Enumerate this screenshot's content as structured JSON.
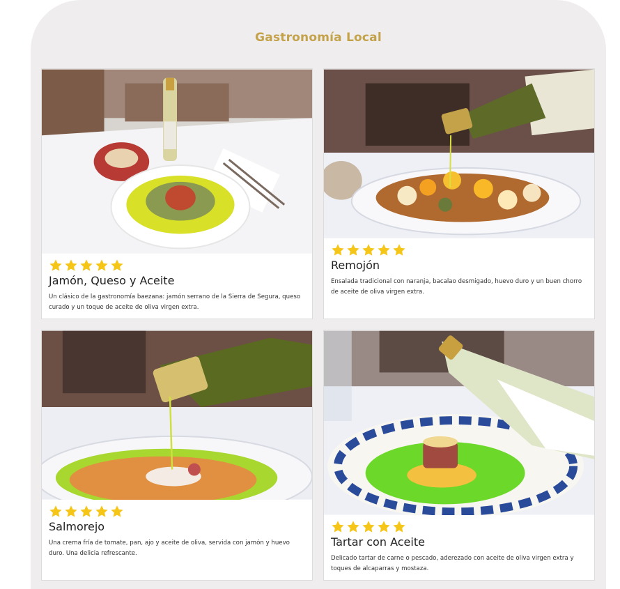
{
  "section": {
    "title": "Gastronomía Local"
  },
  "accent_color": "#c4a24a",
  "star_color": "#f5c518",
  "cards": [
    {
      "rating": 5,
      "image_icon": "dish-photo-icon",
      "title": "Jamón, Queso y Aceite",
      "description": "Un clásico de la gastronomía baezana: jamón serrano de la Sierra de Segura, queso curado y un toque de aceite de oliva virgen extra."
    },
    {
      "rating": 5,
      "image_icon": "dish-photo-icon",
      "title": "Remojón",
      "description": "Ensalada tradicional con naranja, bacalao desmigado, huevo duro y un buen chorro de aceite de oliva virgen extra."
    },
    {
      "rating": 5,
      "image_icon": "dish-photo-icon",
      "title": "Salmorejo",
      "description": "Una crema fría de tomate, pan, ajo y aceite de oliva, servida con jamón y huevo duro. Una delicia refrescante."
    },
    {
      "rating": 5,
      "image_icon": "dish-photo-icon",
      "title": "Tartar con Aceite",
      "description": "Delicado tartar de carne o pescado, aderezado con aceite de oliva virgen extra y toques de alcaparras y mostaza."
    }
  ]
}
